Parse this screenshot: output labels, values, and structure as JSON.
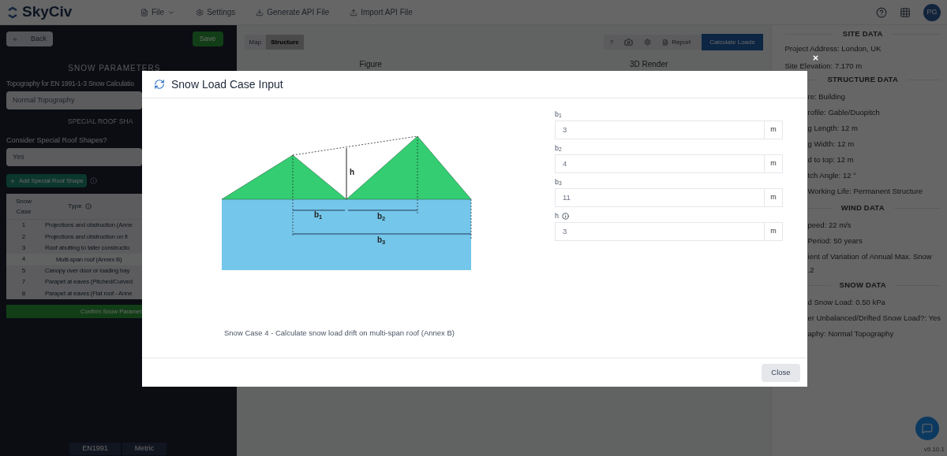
{
  "top_bar": {
    "logo": "SkyCiv",
    "menu": [
      {
        "label": "File",
        "kind": "dropdown"
      },
      {
        "label": "Settings",
        "kind": "gear"
      },
      {
        "label": "Generate API File",
        "kind": "download"
      },
      {
        "label": "Import API File",
        "kind": "upload"
      }
    ],
    "avatar": "PG"
  },
  "left_panel": {
    "back": "Back",
    "save": "Save",
    "heading": "SNOW PARAMETERS",
    "topography_label": "Topography for EN 1991-1-3 Snow Calculatio",
    "topography_value": "Normal Topography",
    "roof_heading": "SPECIAL ROOF SHA",
    "consider_label": "Consider Special Roof Shapes?",
    "consider_value": "Yes",
    "add_button": "Add Special Roof Shape",
    "table": {
      "columns": [
        "Snow Case",
        "Type"
      ],
      "rows": [
        {
          "case": "1",
          "type": "Projections and obstruction (Anne"
        },
        {
          "case": "2",
          "type": "Projections and obstruction on fl"
        },
        {
          "case": "3",
          "type": "Roof abutting to taller constructio"
        },
        {
          "case": "4",
          "type": "Multi-span roof (Annex B)",
          "selected": true
        },
        {
          "case": "5",
          "type": "Canopy over door or loading bay"
        },
        {
          "case": "7",
          "type": "Parapet at eaves (Pitched/Curved"
        },
        {
          "case": "8",
          "type": "Parapet at eaves (Flat roof - Anne"
        }
      ]
    },
    "confirm": "Confirm Snow Paramet",
    "footer_tabs": [
      "EN1991",
      "Metric"
    ]
  },
  "center": {
    "tabs": [
      {
        "label": "Map",
        "selected": false
      },
      {
        "label": "Structure",
        "selected": true
      }
    ],
    "help": "?",
    "report": "Report",
    "calculate": "Calculate Loads",
    "figure_title": "Figure",
    "render_title": "3D Render"
  },
  "right_panel": {
    "sections": [
      {
        "title": "SITE DATA",
        "lines": [
          "Project Address: London, UK",
          "Site Elevation: 7.170 m"
        ]
      },
      {
        "title": "STRUCTURE DATA",
        "lines": [
          "re: Building",
          "rofile: Gable/Duopitch",
          "g Length: 12 m",
          "g Width: 12 m",
          "d to top: 12 m",
          "tch Angle: 12 °",
          "Working Life: Permanent Structure"
        ]
      },
      {
        "title": "WIND DATA",
        "lines": [
          "peed: 22 m/s",
          "Period: 50 years",
          "ient of Variation of Annual Max. Snow",
          ".2"
        ]
      },
      {
        "title": "SNOW DATA",
        "lines": [
          "d Snow Load: 0.50 kPa",
          "er Unbalanced/Drifted Snow Load?: Yes",
          "aphy: Normal Topography"
        ]
      }
    ],
    "version": "v5.10.1"
  },
  "modal": {
    "title": "Snow Load Case Input",
    "diagram_labels": {
      "h": "h",
      "b1": "b$_{1}$",
      "b2": "b$_{2}$",
      "b3": "b$_{3}$"
    },
    "caption": "Snow Case 4 - Calculate snow load drift on multi-span roof (Annex B)",
    "fields": [
      {
        "label": "b$_{1}$",
        "value": "3",
        "unit": "m",
        "info": false
      },
      {
        "label": "b$_{2}$",
        "value": "4",
        "unit": "m",
        "info": false
      },
      {
        "label": "b$_{3}$",
        "value": "11",
        "unit": "m",
        "info": false
      },
      {
        "label": "h",
        "value": "3",
        "unit": "m",
        "info": true
      }
    ],
    "close": "Close"
  }
}
